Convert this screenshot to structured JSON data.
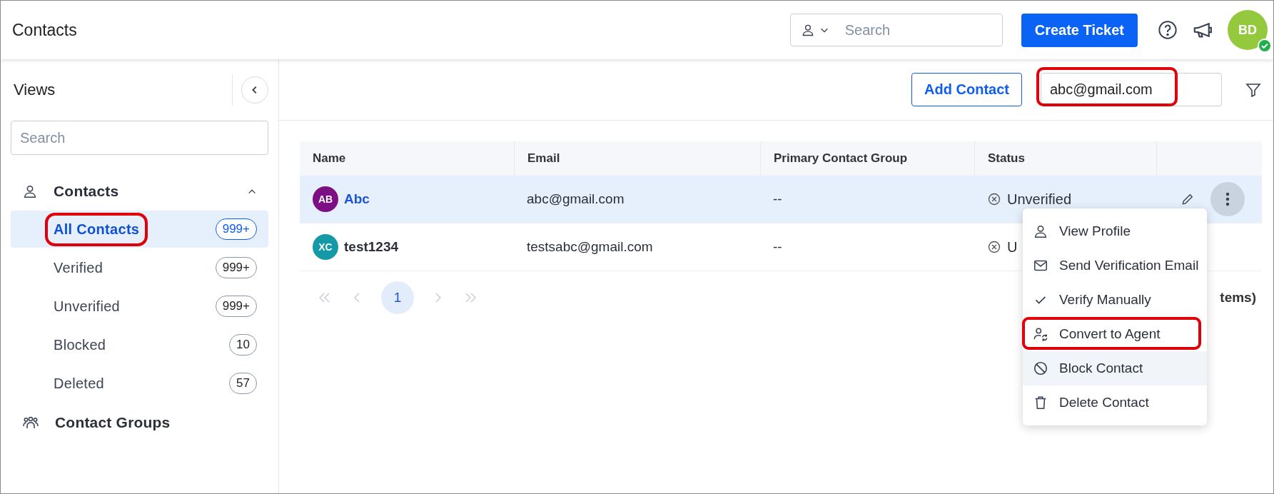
{
  "header": {
    "title": "Contacts",
    "search": {
      "placeholder": "Search"
    },
    "create_button": "Create Ticket",
    "avatar": {
      "initials": "BD",
      "online": true
    }
  },
  "sidebar": {
    "title": "Views",
    "search": {
      "placeholder": "Search"
    },
    "groups": [
      {
        "label": "Contacts",
        "kind": "person",
        "expanded": true,
        "children": [
          {
            "label": "All Contacts",
            "count": "999+",
            "selected": true,
            "highlighted": true
          },
          {
            "label": "Verified",
            "count": "999+",
            "selected": false,
            "highlighted": false
          },
          {
            "label": "Unverified",
            "count": "999+",
            "selected": false,
            "highlighted": false
          },
          {
            "label": "Blocked",
            "count": "10",
            "selected": false,
            "highlighted": false
          },
          {
            "label": "Deleted",
            "count": "57",
            "selected": false,
            "highlighted": false
          }
        ]
      },
      {
        "label": "Contact Groups",
        "kind": "people"
      }
    ]
  },
  "toolbar": {
    "add_button": "Add Contact",
    "search": {
      "value": "abc@gmail.com",
      "highlighted": true
    }
  },
  "table": {
    "columns": [
      "Name",
      "Email",
      "Primary Contact Group",
      "Status"
    ],
    "rows": [
      {
        "initials": "AB",
        "color": "#7b0f83",
        "name": "Abc",
        "email": "abc@gmail.com",
        "group": "--",
        "status": "Unverified",
        "selected": true
      },
      {
        "initials": "XC",
        "color": "#139aa6",
        "name": "test1234",
        "email": "testsabc@gmail.com",
        "group": "--",
        "status": "U",
        "selected": false
      }
    ]
  },
  "pagination": {
    "pages": [
      {
        "label": "1",
        "selected": true
      }
    ],
    "summary": "tems)"
  },
  "menu": {
    "items": [
      {
        "label": "View Profile",
        "kind": "person",
        "hovered": false,
        "highlighted": false
      },
      {
        "label": "Send Verification Email",
        "kind": "mail",
        "hovered": false,
        "highlighted": false
      },
      {
        "label": "Verify Manually",
        "kind": "check",
        "hovered": false,
        "highlighted": false
      },
      {
        "label": "Convert to Agent",
        "kind": "convert",
        "hovered": false,
        "highlighted": true
      },
      {
        "label": "Block Contact",
        "kind": "block",
        "hovered": true,
        "highlighted": false
      },
      {
        "label": "Delete Contact",
        "kind": "trash",
        "hovered": false,
        "highlighted": false
      }
    ]
  }
}
